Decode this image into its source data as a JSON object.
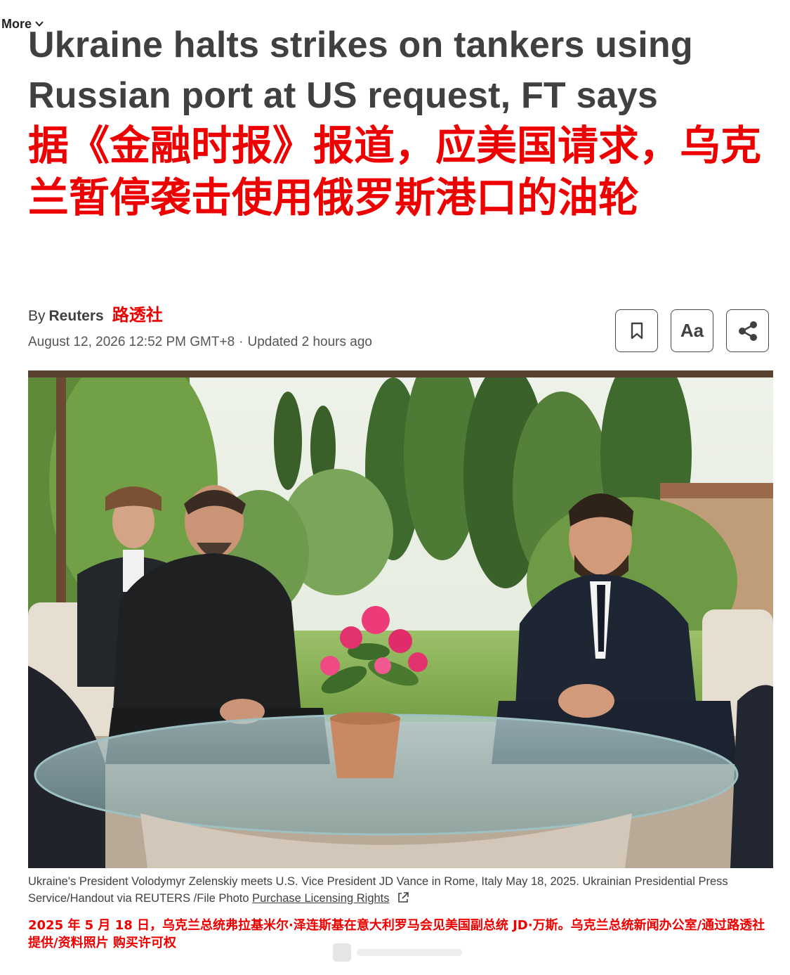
{
  "nav": {
    "more_label": "More"
  },
  "headline": {
    "english": "Ukraine halts strikes on tankers using Russian port at US request, FT says",
    "chinese": "据《金融时报》报道，应美国请求，乌克兰暂停袭击使用俄罗斯港口的油轮"
  },
  "byline": {
    "prefix": "By",
    "author": "Reuters",
    "author_zh": "路透社"
  },
  "dateline": {
    "published": "August 12, 2026 12:52 PM GMT+8",
    "separator": "·",
    "updated": "Updated 2 hours ago"
  },
  "toolbar": {
    "bookmark_icon": "bookmark-icon",
    "text_size_label": "Aa",
    "share_icon": "share-icon"
  },
  "photo": {
    "subject": "news-photo"
  },
  "caption": {
    "english": "Ukraine's President Volodymyr Zelenskiy meets U.S. Vice President JD Vance in Rome, Italy May 18, 2025. Ukrainian Presidential Press Service/Handout via REUTERS /File Photo",
    "licensing_link": "Purchase Licensing Rights",
    "chinese": "2025 年 5 月 18 日，乌克兰总统弗拉基米尔·泽连斯基在意大利罗马会见美国副总统 JD·万斯。乌克兰总统新闻办公室/通过路透社提供/资料照片 购买许可权"
  },
  "colors": {
    "accent_red": "#ee0000",
    "text_gray": "#404040"
  }
}
